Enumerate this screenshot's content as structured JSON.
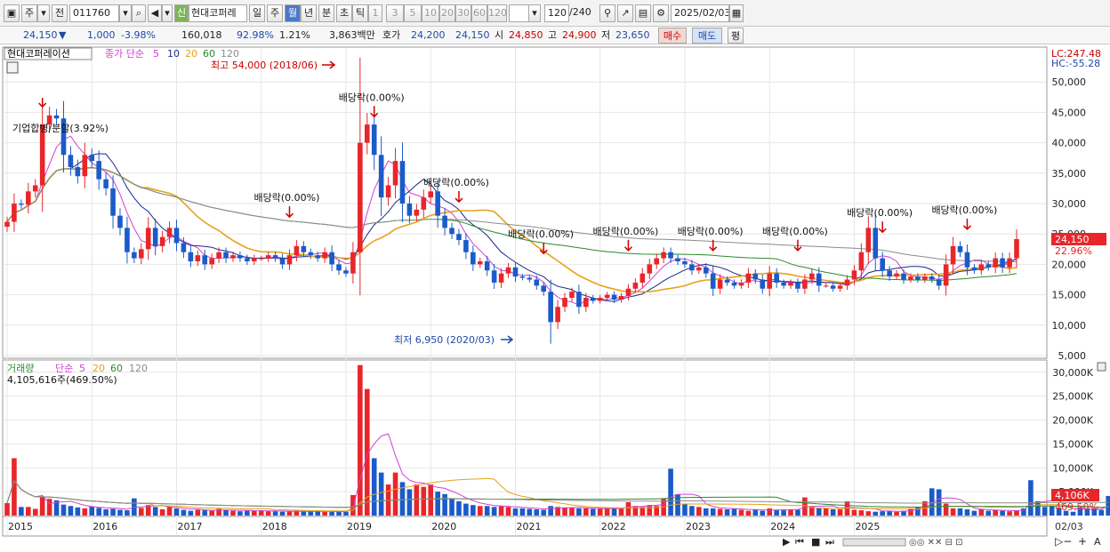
{
  "toolbar": {
    "period_type": "주",
    "market_label": "전",
    "stock_code": "011760",
    "new_badge": "신",
    "stock_name": "현대코퍼레",
    "period_buttons": [
      "일",
      "주",
      "월",
      "년",
      "분",
      "초",
      "틱"
    ],
    "active_period": "월",
    "count_buttons": [
      "1",
      "3",
      "5",
      "10",
      "20",
      "30",
      "60",
      "120"
    ],
    "count_display": "120",
    "count_total": "/240",
    "date": "2025/02/03"
  },
  "info": {
    "price": "24,150",
    "change": "1,000",
    "change_pct": "-3.98%",
    "volume": "160,018",
    "vol_ratio": "92.98%",
    "turnover": "1.21%",
    "amount": "3,863백만",
    "quote_label": "호가",
    "quote_ask": "24,200",
    "quote_bid": "24,150",
    "open_label": "시",
    "open": "24,850",
    "high_label": "고",
    "high": "24,900",
    "low_label": "저",
    "low": "23,650",
    "buy_label": "매수",
    "sell_label": "매도",
    "eval_label": "평"
  },
  "price_panel": {
    "legend": [
      "현대코퍼레이션",
      "종가 단순",
      "5",
      "10",
      "20",
      "60",
      "120"
    ],
    "lc": "LC:247.48",
    "hc": "HC:-55.28",
    "current_label": "24,150",
    "current_pct": "22.96%",
    "high_marker": "최고 54,000 (2018/06)",
    "low_marker": "최저 6,950 (2020/03)",
    "annotations": [
      "기업합병/분할(3.92%)",
      "배당락(0.00%)"
    ]
  },
  "volume_panel": {
    "legend": [
      "거래량",
      "단순",
      "5",
      "20",
      "60",
      "120"
    ],
    "value_label": "4,105,616주(469.50%)",
    "current_label": "4,106K",
    "current_pct": "469.50%"
  },
  "x_axis": {
    "years": [
      "2015",
      "2016",
      "2017",
      "2018",
      "2019",
      "2020",
      "2021",
      "2022",
      "2023",
      "2024",
      "2025"
    ],
    "end_label": "02/03"
  },
  "colors": {
    "up": "#e8262a",
    "down": "#1a5bc9",
    "ma5": "#d23fd2",
    "ma10": "#1b2a8c",
    "ma20": "#e6a21c",
    "ma60": "#2c8a2c",
    "ma120": "#8c8c8c"
  },
  "chart_data": [
    {
      "type": "candlestick",
      "title": "현대코퍼레이션",
      "x_start": "2015/01",
      "interval": "month",
      "ylim": [
        5000,
        55000
      ],
      "y_ticks": [
        5000,
        10000,
        15000,
        20000,
        25000,
        30000,
        35000,
        40000,
        45000,
        50000
      ],
      "close": [
        27000,
        30000,
        29800,
        32000,
        33000,
        43000,
        44500,
        44000,
        38000,
        36000,
        34500,
        38000,
        37000,
        34000,
        32500,
        28000,
        26000,
        22000,
        21000,
        22500,
        26000,
        23000,
        24500,
        26000,
        23500,
        22000,
        20500,
        21500,
        20000,
        21000,
        22000,
        21000,
        21500,
        21000,
        20500,
        21000,
        21000,
        21500,
        21000,
        20000,
        21500,
        23000,
        22000,
        21500,
        21000,
        22000,
        20000,
        19000,
        18500,
        22000,
        40000,
        43000,
        38000,
        31000,
        33000,
        37000,
        30000,
        28000,
        29000,
        31000,
        32000,
        28000,
        26000,
        25000,
        24000,
        22000,
        20000,
        20500,
        19000,
        17000,
        18500,
        19500,
        18000,
        17800,
        17500,
        16500,
        15500,
        10500,
        13000,
        14500,
        15500,
        13000,
        14500,
        14000,
        14500,
        15000,
        14200,
        14800,
        16000,
        17000,
        18500,
        20000,
        21000,
        22000,
        21000,
        20500,
        20000,
        19000,
        19500,
        18500,
        16000,
        17500,
        17000,
        16500,
        17000,
        18500,
        17500,
        16000,
        18500,
        17000,
        16500,
        17000,
        16000,
        17500,
        18500,
        16500,
        16500,
        16000,
        16500,
        17500,
        19000,
        22000,
        26000,
        21000,
        19000,
        18000,
        18500,
        17500,
        18000,
        17500,
        18000,
        17500,
        16500,
        20000,
        23000,
        22000,
        19500,
        19000,
        20000,
        19500,
        21000,
        19500,
        21000,
        24150
      ],
      "low_price": 6950,
      "high_price": 54000
    },
    {
      "type": "bar",
      "title": "거래량",
      "ylim": [
        0,
        32000
      ],
      "y_ticks": [
        5000,
        10000,
        15000,
        20000,
        25000,
        30000
      ],
      "unit": "K",
      "values": [
        2600,
        12000,
        1800,
        1800,
        1400,
        4000,
        3500,
        3200,
        2300,
        2000,
        1700,
        1500,
        1900,
        1600,
        1300,
        1400,
        1200,
        1100,
        3600,
        1600,
        2200,
        1800,
        1300,
        1900,
        1500,
        1200,
        1000,
        1200,
        1100,
        1000,
        1400,
        1200,
        1000,
        900,
        1000,
        1000,
        1100,
        900,
        900,
        800,
        900,
        1000,
        900,
        900,
        900,
        800,
        800,
        800,
        800,
        4300,
        31500,
        26500,
        12000,
        9000,
        6500,
        9000,
        7000,
        5500,
        6500,
        6000,
        6500,
        5000,
        4500,
        3500,
        3000,
        2500,
        2200,
        2000,
        2000,
        1800,
        2000,
        1800,
        1500,
        1500,
        1400,
        1300,
        1200,
        2000,
        1800,
        1700,
        1600,
        1500,
        1500,
        1400,
        1400,
        1600,
        1500,
        1400,
        2800,
        2000,
        1800,
        2200,
        2000,
        3500,
        9800,
        4500,
        2500,
        2000,
        1800,
        1500,
        1500,
        1400,
        1300,
        1500,
        1200,
        1000,
        1200,
        1000,
        1500,
        1200,
        1100,
        1300,
        1200,
        3800,
        2000,
        1500,
        1500,
        1300,
        1300,
        3000,
        1200,
        1100,
        900,
        800,
        900,
        1000,
        800,
        1000,
        1500,
        1800,
        3000,
        5700,
        5500,
        2500,
        1500,
        1500,
        1300,
        1000,
        1300,
        1000,
        1200,
        1000,
        900,
        1000,
        1500,
        7400,
        3000,
        1800,
        2000,
        1600,
        1000,
        800,
        1800,
        1500,
        1500,
        1200,
        4106
      ]
    }
  ]
}
